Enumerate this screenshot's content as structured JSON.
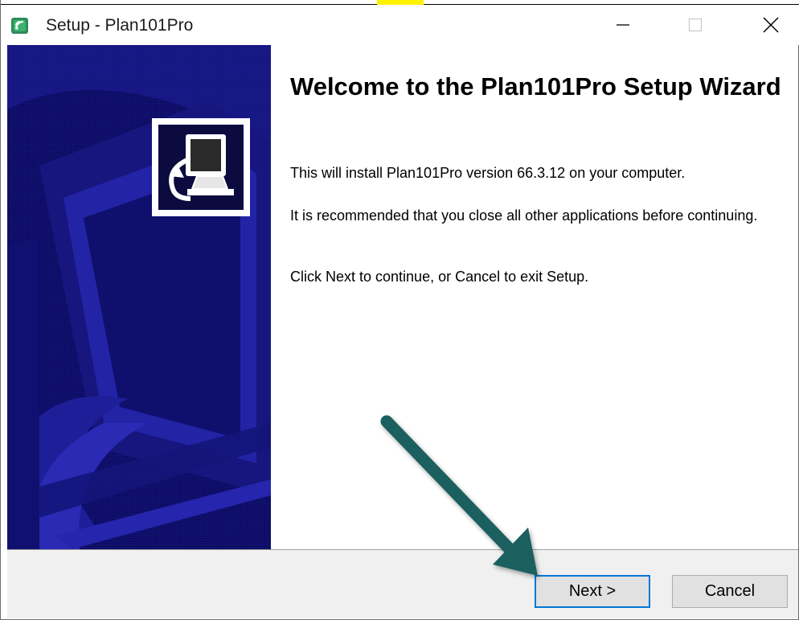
{
  "window": {
    "title": "Setup - Plan101Pro",
    "controls": {
      "minimize_icon": "minimize-icon",
      "maximize_icon": "maximize-icon",
      "close_icon": "close-icon"
    }
  },
  "wizard": {
    "heading": "Welcome to the Plan101Pro Setup Wizard",
    "paragraphs": [
      "This will install Plan101Pro version 66.3.12 on your computer.",
      "It is recommended that you close all other applications before continuing.",
      "Click Next to continue, or Cancel to exit Setup."
    ],
    "logo_icon": "computer-install-icon"
  },
  "buttons": {
    "next_label": "Next >",
    "cancel_label": "Cancel"
  },
  "annotation": {
    "arrow_icon": "pointer-arrow-icon",
    "arrow_color": "#1f5f5f"
  },
  "colors": {
    "banner": "#0d0d66",
    "focus_border": "#0078d7",
    "footer": "#f0f0f0"
  }
}
